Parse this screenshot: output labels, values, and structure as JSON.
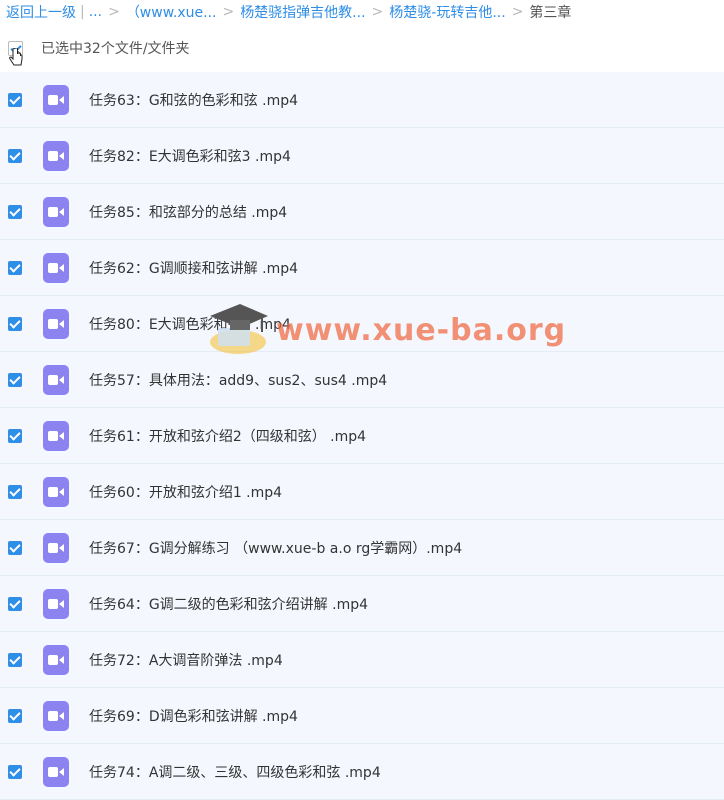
{
  "breadcrumb": {
    "back": "返回上一级",
    "divider": "|",
    "ellipsis": "...",
    "items": [
      "（www.xue...",
      "杨楚骁指弹吉他教...",
      "杨楚骁-玩转吉他..."
    ],
    "current": "第三章",
    "separator": ">"
  },
  "selection": {
    "text": "已选中32个文件/文件夹"
  },
  "files": [
    "任务63：G和弦的色彩和弦 .mp4",
    "任务82：E大调色彩和弦3 .mp4",
    "任务85：和弦部分的总结 .mp4",
    "任务62：G调顺接和弦讲解 .mp4",
    "任务80：E大调色彩和弦2 .mp4",
    "任务57：具体用法：add9、sus2、sus4 .mp4",
    "任务61：开放和弦介绍2（四级和弦） .mp4",
    "任务60：开放和弦介绍1 .mp4",
    "任务67：G调分解练习 （www.xue-b a.o rg学霸网）.mp4",
    "任务64：G调二级的色彩和弦介绍讲解 .mp4",
    "任务72：A大调音阶弹法 .mp4",
    "任务69：D调色彩和弦讲解 .mp4",
    "任务74：A调二级、三级、四级色彩和弦 .mp4"
  ],
  "watermark": {
    "text": "www.xue-ba.org"
  },
  "colors": {
    "accent": "#2f8ee6",
    "video_icon": "#8b83ef",
    "row_bg": "#f4f8fe"
  }
}
